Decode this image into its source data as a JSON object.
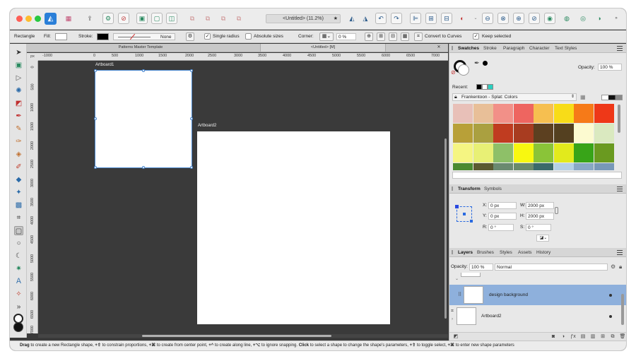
{
  "window": {
    "title": "<Untitled> (11.2%)",
    "star": "★"
  },
  "context_bar": {
    "shape": "Rectangle",
    "fill_label": "Fill:",
    "stroke_label": "Stroke:",
    "stroke_style": "None",
    "single_radius": "Single radius",
    "absolute_sizes": "Absolute sizes",
    "corner_label": "Corner:",
    "corner_value": "0 %",
    "convert": "Convert to Curves",
    "keep_selected": "Keep selected",
    "fill_color": "#ffffff",
    "stroke_color": "#000000"
  },
  "doc_tabs": [
    "Patterns Master Template",
    "<Untitled> [M]"
  ],
  "ruler": {
    "unit": "px",
    "h_labels": [
      "-1000",
      "0",
      "500",
      "1000",
      "1500",
      "2000",
      "2500",
      "3000",
      "3500",
      "4000",
      "4500",
      "5000",
      "5500",
      "6000",
      "6500",
      "7000"
    ],
    "v_labels": [
      "0",
      "500",
      "1000",
      "1500",
      "2000",
      "2500",
      "3000",
      "3500",
      "4000",
      "4500",
      "5000",
      "5500",
      "6000",
      "6500",
      "7000"
    ]
  },
  "artboards": [
    {
      "name": "Artboard1",
      "selected": true
    },
    {
      "name": "Artboard2",
      "selected": false
    }
  ],
  "swatches_panel": {
    "tabs": [
      "Swatches",
      "Stroke",
      "Paragraph",
      "Character",
      "Text Styles"
    ],
    "opacity_label": "Opacity:",
    "opacity_value": "100 %",
    "recent_label": "Recent:",
    "recent_colors": [
      "#000000",
      "#ffffff",
      "#2ad0c0"
    ],
    "palette_name": "Frankentoon - Splat: Colors",
    "colors": [
      "#e8c0b8",
      "#e8bf98",
      "#f29088",
      "#ee6560",
      "#f6bf50",
      "#f8dc18",
      "#f67a18",
      "#ee3818",
      "#b8a038",
      "#aaa040",
      "#c03c20",
      "#a83c20",
      "#5c4020",
      "#544020",
      "#fcfad0",
      "#dae9c0",
      "#f5f582",
      "#e8f075",
      "#8ec068",
      "#f8f810",
      "#8ac438",
      "#e2ea1c",
      "#38a418",
      "#6a9a20",
      "#4a8a30",
      "#5a5a30",
      "#6a8a70",
      "#6a8a6a",
      "#3a6a6a",
      "#b4d0e4",
      "#88a8c4",
      "#7898b8"
    ]
  },
  "transform_panel": {
    "tabs": [
      "Transform",
      "Symbols"
    ],
    "x_label": "X:",
    "x_value": "0 px",
    "y_label": "Y:",
    "y_value": "0 px",
    "w_label": "W:",
    "w_value": "2000 px",
    "h_label": "H:",
    "h_value": "2000 px",
    "r_label": "R:",
    "r_value": "0 °",
    "s_label": "S:",
    "s_value": "0 °"
  },
  "layers_panel": {
    "tabs": [
      "Layers",
      "Brushes",
      "Styles",
      "Assets",
      "History"
    ],
    "opacity_label": "Opacity:",
    "opacity_value": "100 %",
    "blend_mode": "Normal",
    "layers": [
      {
        "name": "design background",
        "selected": true
      },
      {
        "name": "Artboard2",
        "selected": false
      }
    ]
  },
  "status": {
    "k1": "Drag",
    "t1": " to create a new Rectangle shape, ",
    "k2": "+⇧",
    "t2": " to constrain proportions, ",
    "k3": "+⌘",
    "t3": " to create from center point, ",
    "k4": "+^",
    "t4": " to create along line, ",
    "k5": "+⌥",
    "t5": " to ignore snapping. ",
    "k6": "Click",
    "t6": " to select a shape to change the shape's parameters, ",
    "k7": "+⇧",
    "t7": " to toggle select, ",
    "k8": "+⌘",
    "t8": " to enter new shape parameters"
  }
}
